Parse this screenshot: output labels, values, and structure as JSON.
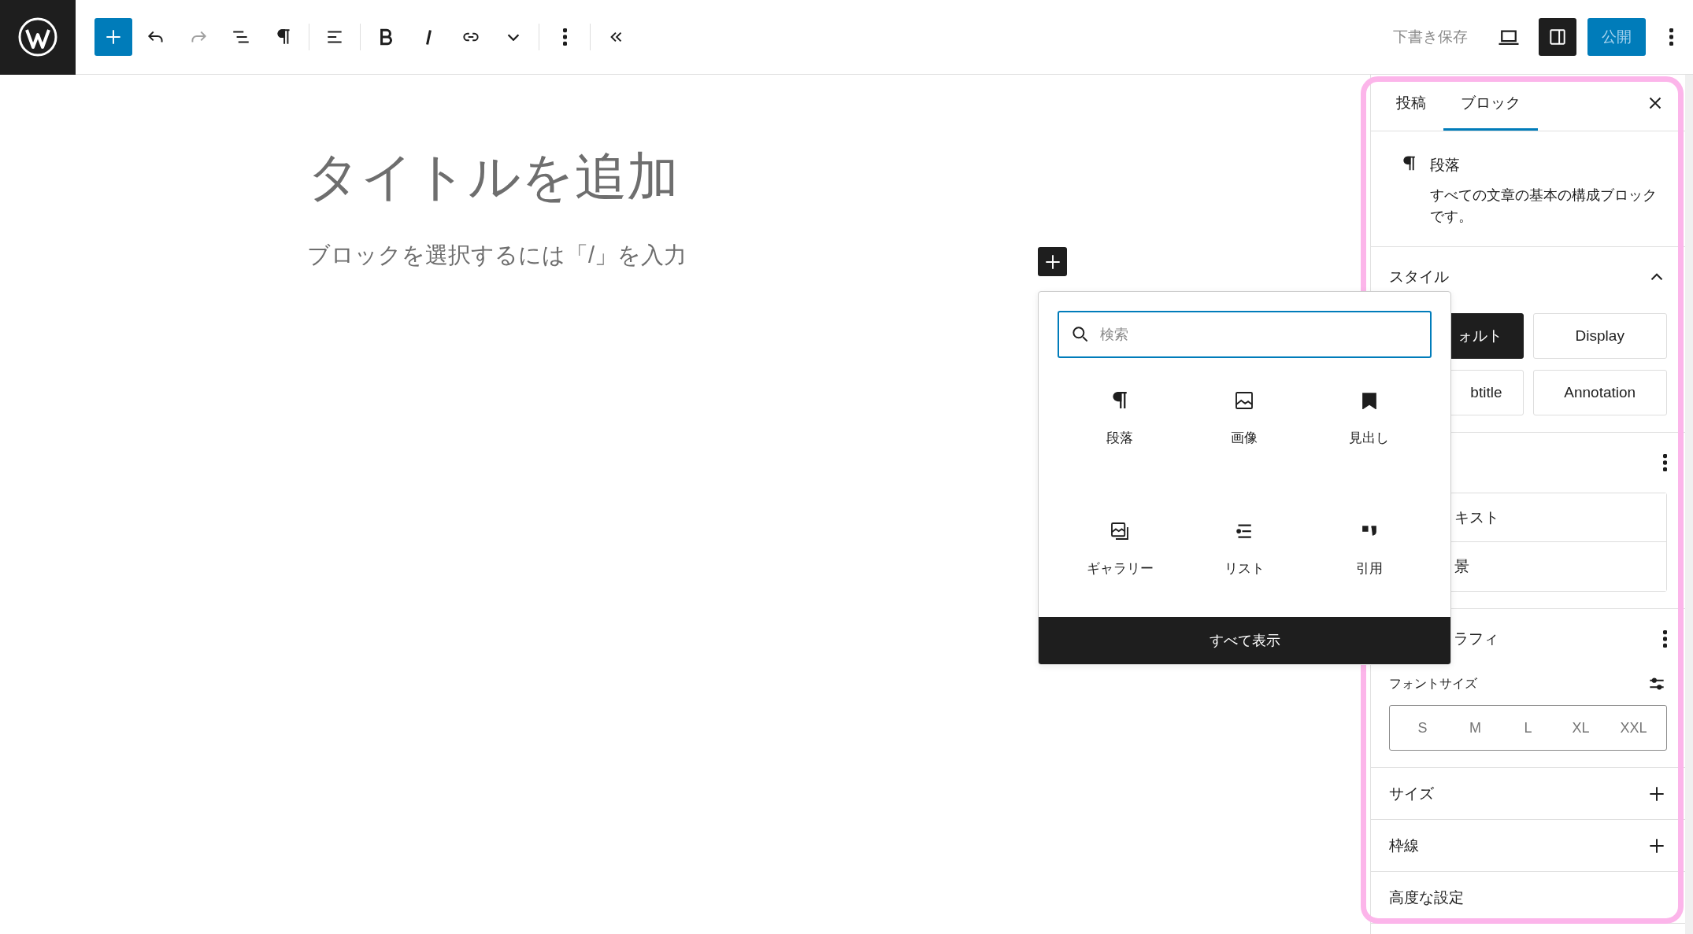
{
  "toolbar": {
    "tools": [
      {
        "kind": "inserter",
        "pressed": true
      },
      {
        "kind": "undo",
        "disabled": false
      },
      {
        "kind": "redo",
        "disabled": true
      },
      {
        "kind": "list-view",
        "disabled": false
      },
      {
        "kind": "paragraph",
        "disabled": false
      },
      {
        "kind": "separator"
      },
      {
        "kind": "align",
        "disabled": false
      },
      {
        "kind": "separator"
      },
      {
        "kind": "bold",
        "disabled": false
      },
      {
        "kind": "italic",
        "disabled": false
      },
      {
        "kind": "link",
        "disabled": false
      },
      {
        "kind": "more",
        "disabled": false
      },
      {
        "kind": "separator"
      },
      {
        "kind": "options",
        "disabled": false
      },
      {
        "kind": "separator"
      },
      {
        "kind": "collapse",
        "disabled": false
      }
    ],
    "save_draft": "下書き保存",
    "settings_pressed": true,
    "publish": "公開"
  },
  "editor": {
    "title_placeholder": "タイトルを追加",
    "paragraph_placeholder": "ブロックを選択するには「/」を入力"
  },
  "inserter": {
    "search_placeholder": "検索",
    "blocks": [
      {
        "kind": "paragraph",
        "label": "段落"
      },
      {
        "kind": "image",
        "label": "画像"
      },
      {
        "kind": "heading",
        "label": "見出し"
      },
      {
        "kind": "gallery",
        "label": "ギャラリー"
      },
      {
        "kind": "list",
        "label": "リスト"
      },
      {
        "kind": "quote",
        "label": "引用"
      }
    ],
    "browse_all": "すべて表示"
  },
  "sidebar": {
    "tabs": [
      {
        "label": "投稿",
        "selected": false
      },
      {
        "label": "ブロック",
        "selected": true
      }
    ],
    "block_card": {
      "name": "段落",
      "description": "すべての文章の基本の構成ブロックです。"
    },
    "panels": [
      {
        "kind": "styles",
        "title": "スタイル",
        "expanded": true,
        "styles": [
          {
            "label": "ォルト",
            "selected": true
          },
          {
            "label": "Display",
            "selected": false
          },
          {
            "label": "btitle",
            "selected": false
          },
          {
            "label": "Annotation",
            "selected": false
          }
        ]
      },
      {
        "kind": "color",
        "items": [
          "キスト",
          "景"
        ]
      },
      {
        "kind": "typography",
        "title": "ラフィ",
        "font_size_label": "フォントサイズ",
        "sizes": [
          {
            "label": "S",
            "selected": false
          },
          {
            "label": "M",
            "selected": false
          },
          {
            "label": "L",
            "selected": false
          },
          {
            "label": "XL",
            "selected": false
          },
          {
            "label": "XXL",
            "selected": false
          }
        ]
      },
      {
        "kind": "section",
        "title": "サイズ",
        "expanded": false
      },
      {
        "kind": "section",
        "title": "枠線",
        "expanded": false
      },
      {
        "kind": "section",
        "title": "高度な設定"
      }
    ]
  }
}
